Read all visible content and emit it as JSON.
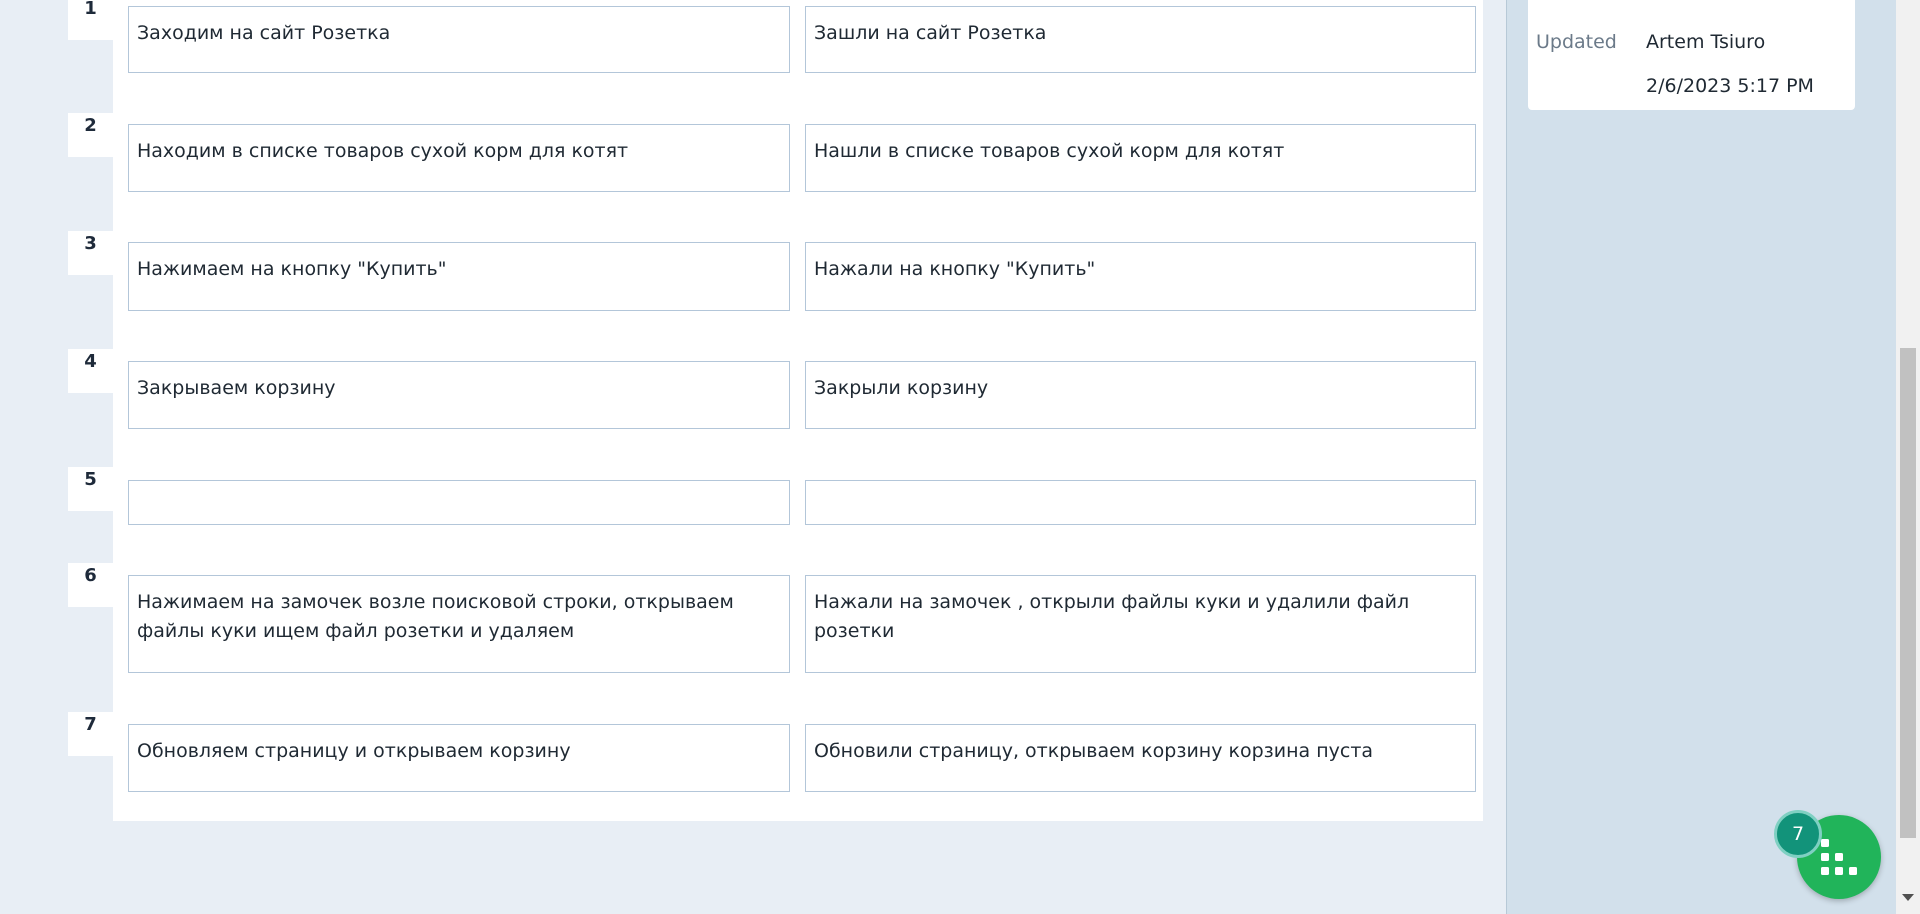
{
  "steps": [
    {
      "num": "1",
      "action": "Заходим на сайт Розетка",
      "result": "Зашли на сайт Розетка"
    },
    {
      "num": "2",
      "action": "Находим в списке товаров сухой корм для котят",
      "result": "Нашли в списке товаров сухой корм для котят"
    },
    {
      "num": "3",
      "action": "Нажимаем на кнопку \"Купить\"",
      "result": "Нажали на кнопку \"Купить\""
    },
    {
      "num": "4",
      "action": "Закрываем корзину",
      "result": "Закрыли корзину"
    },
    {
      "num": "5",
      "action": "",
      "result": ""
    },
    {
      "num": "6",
      "action": "Нажимаем на замочек возле поисковой строки, открываем файлы куки ищем файл розетки и удаляем",
      "result": "Нажали на замочек , открыли файлы куки и удалили файл розетки"
    },
    {
      "num": "7",
      "action": "Обновляем страницу и открываем корзину",
      "result": "Обновили страницу, открываем корзину корзина пуста"
    }
  ],
  "sidebar": {
    "updated_label": "Updated",
    "updated_by": "Artem Tsiuro",
    "updated_at": "2/6/2023 5:17 PM"
  },
  "fab": {
    "badge_count": "7",
    "icon": "grid-steps-icon",
    "color": "#21b45a"
  }
}
